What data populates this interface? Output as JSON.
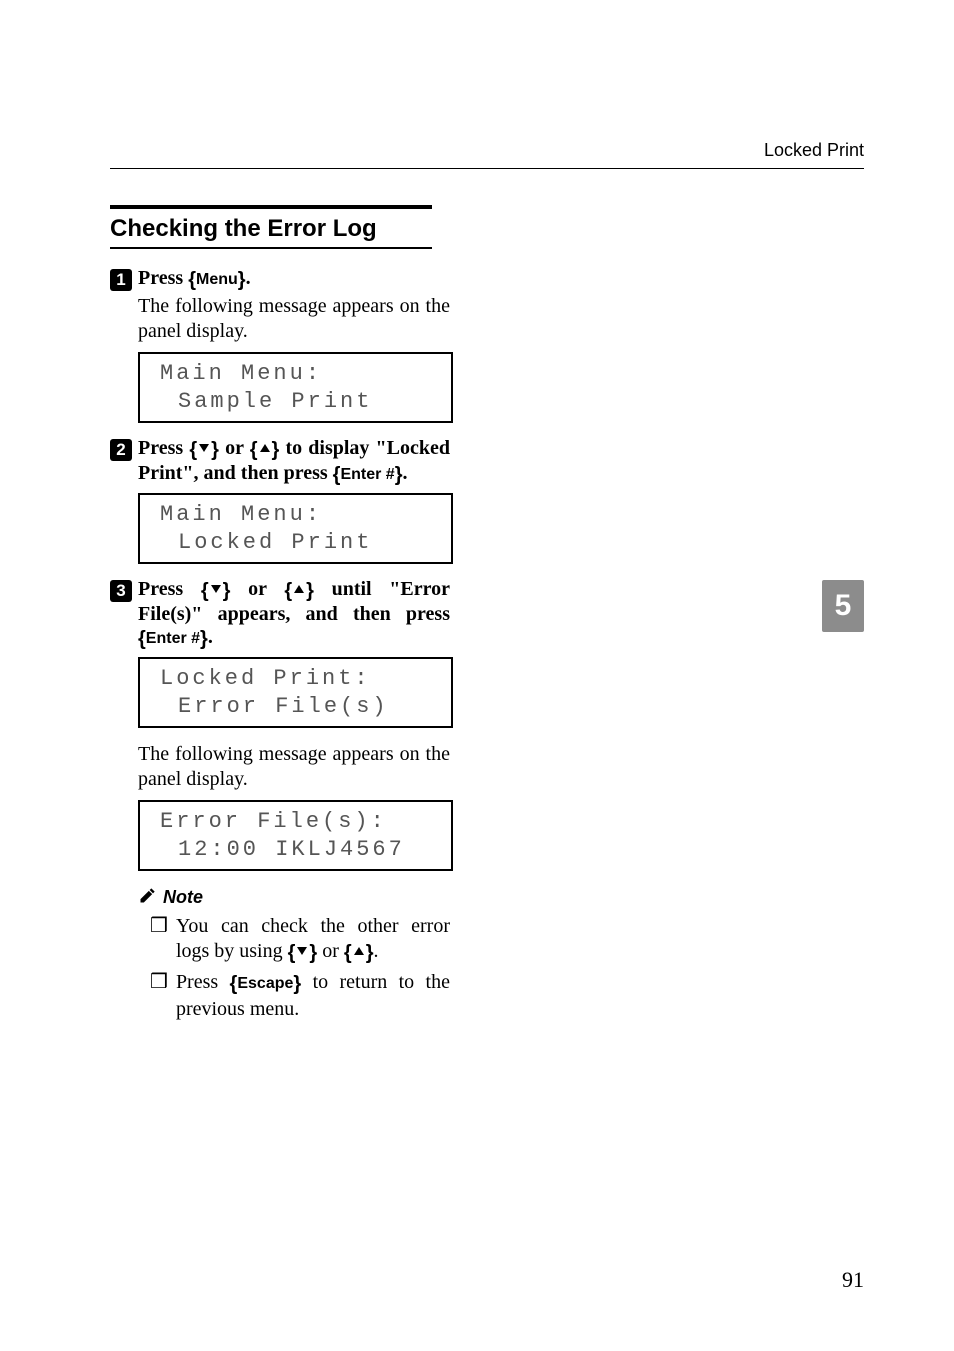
{
  "header": {
    "section_label": "Locked Print"
  },
  "heading": "Checking the Error Log",
  "chapter_tab": "5",
  "page_number": "91",
  "steps": {
    "s1": {
      "num": "1",
      "text_before": "Press ",
      "key": "Menu",
      "text_after": ".",
      "body": "The following message appears on the panel display.",
      "lcd": {
        "l1": "Main Menu:",
        "l2": "Sample Print"
      }
    },
    "s2": {
      "num": "2",
      "text_a": "Press ",
      "text_b": " or ",
      "text_c": " to display \"Locked Print\", and then press ",
      "key": "Enter #",
      "text_d": ".",
      "lcd": {
        "l1": "Main Menu:",
        "l2": "Locked Print"
      }
    },
    "s3": {
      "num": "3",
      "text_a": "Press ",
      "text_b": " or ",
      "text_c": " until \"Error File(s)\" appears, and then press ",
      "key": "Enter #",
      "text_d": ".",
      "lcd1": {
        "l1": "Locked Print:",
        "l2": "Error File(s)"
      },
      "body": "The following message appears on the panel display.",
      "lcd2": {
        "l1": "Error File(s):",
        "l2": "12:00 IKLJ4567"
      }
    }
  },
  "note": {
    "label": "Note",
    "items": {
      "i1": {
        "a": "You can check the other error logs by using ",
        "b": " or ",
        "c": "."
      },
      "i2": {
        "a": "Press ",
        "key": "Escape",
        "b": " to return to the previous menu."
      }
    }
  }
}
